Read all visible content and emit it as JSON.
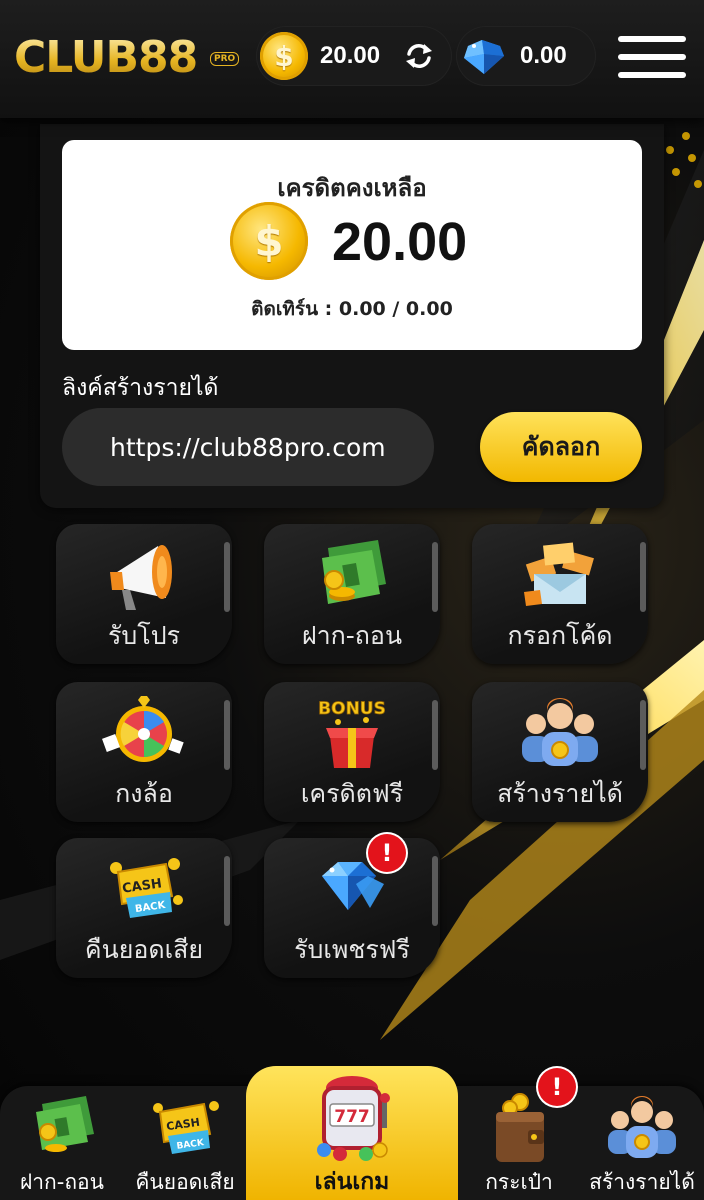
{
  "header": {
    "logo_text": "CLUB88",
    "logo_badge": "PRO",
    "credit_value": "20.00",
    "credit_coin_symbol": "$",
    "gem_value": "0.00"
  },
  "credit_card": {
    "title": "เครดิตคงเหลือ",
    "coin_symbol": "$",
    "amount": "20.00",
    "turnover": "ติดเทิร์น : 0.00 / 0.00"
  },
  "referral": {
    "label": "ลิงค์สร้างรายได้",
    "link_value": "https://club88pro.com",
    "copy_label": "คัดลอก"
  },
  "menu": {
    "items": [
      {
        "label": "รับโปร",
        "icon": "megaphone-icon"
      },
      {
        "label": "ฝาก-ถอน",
        "icon": "money-icon"
      },
      {
        "label": "กรอกโค้ด",
        "icon": "envelope-icon"
      },
      {
        "label": "กงล้อ",
        "icon": "wheel-icon"
      },
      {
        "label": "เครดิตฟรี",
        "icon": "bonus-box-icon"
      },
      {
        "label": "สร้างรายได้",
        "icon": "team-icon"
      },
      {
        "label": "คืนยอดเสีย",
        "icon": "cashback-icon"
      },
      {
        "label": "รับเพชรฟรี",
        "icon": "diamond-icon",
        "badge": "!"
      }
    ]
  },
  "bottom_nav": {
    "items": [
      {
        "label": "ฝาก-ถอน",
        "icon": "money-icon"
      },
      {
        "label": "คืนยอดเสีย",
        "icon": "cashback-icon"
      },
      {
        "label": "เล่นเกม",
        "icon": "slot-machine-icon",
        "active": true
      },
      {
        "label": "กระเป๋า",
        "icon": "wallet-icon",
        "badge": "!"
      },
      {
        "label": "สร้างรายได้",
        "icon": "team-icon"
      }
    ]
  },
  "colors": {
    "accent": "#f5c518",
    "badge": "#e3131b",
    "background": "#0b0b0b"
  }
}
